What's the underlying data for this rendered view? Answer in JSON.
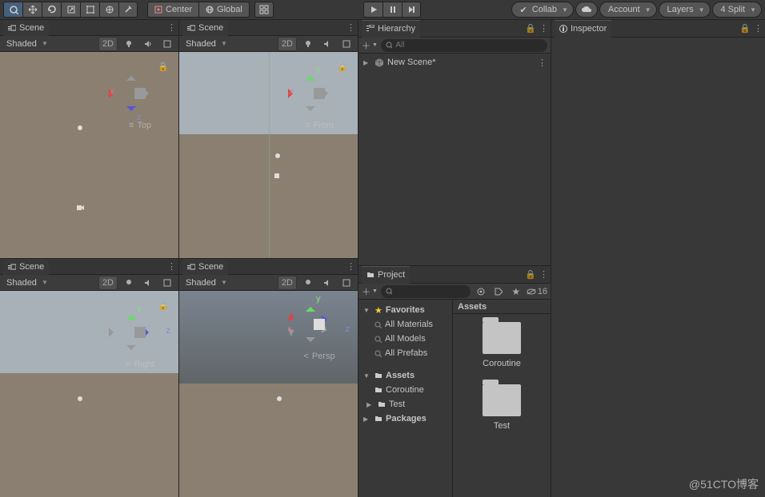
{
  "toolbar": {
    "pivot": "Center",
    "space": "Global",
    "collab": "Collab",
    "account": "Account",
    "layers": "Layers",
    "layout": "4 Split"
  },
  "panels": {
    "scene": "Scene",
    "hierarchy": "Hierarchy",
    "inspector": "Inspector",
    "project": "Project"
  },
  "viewport": {
    "shading": "Shaded",
    "btn2d": "2D",
    "labels": {
      "top": "Top",
      "front": "Front",
      "right": "Right",
      "persp": "Persp"
    },
    "axis": {
      "x": "x",
      "y": "y",
      "z": "z"
    }
  },
  "hierarchy": {
    "search_placeholder": "All",
    "root": "New Scene*"
  },
  "project": {
    "favorites": "Favorites",
    "fav_items": [
      "All Materials",
      "All Models",
      "All Prefabs"
    ],
    "assets": "Assets",
    "packages": "Packages",
    "asset_folders": [
      "Coroutine",
      "Test"
    ],
    "breadcrumb": "Assets",
    "hidden_count": "16"
  },
  "watermark": "@51CTO博客"
}
